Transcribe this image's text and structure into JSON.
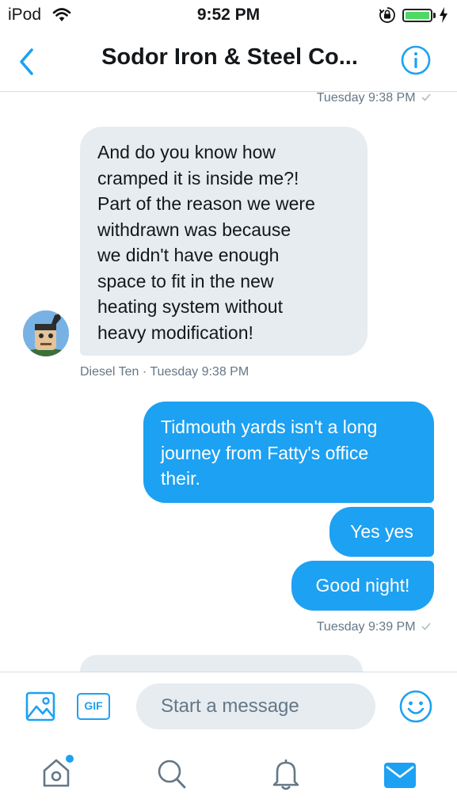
{
  "status_bar": {
    "carrier": "iPod",
    "time": "9:52 PM"
  },
  "header": {
    "title": "Sodor Iron & Steel Co..."
  },
  "messages": [
    {
      "kind": "timestamp",
      "text": "Tuesday 9:38 PM"
    },
    {
      "kind": "received",
      "lines": [
        "And do you know how",
        "cramped it is inside me?!",
        "Part of the reason we were",
        "withdrawn was because",
        "we didn't have enough",
        "space to fit in the new",
        "heating system without",
        "heavy modification!"
      ]
    },
    {
      "kind": "sender",
      "name": "Diesel Ten",
      "time": "Tuesday 9:38 PM"
    },
    {
      "kind": "sent",
      "lines": [
        "Tidmouth yards isn't a long",
        "journey from Fatty's office",
        "their."
      ]
    },
    {
      "kind": "sent",
      "text": "Yes yes"
    },
    {
      "kind": "sent",
      "text": "Good night!"
    },
    {
      "kind": "timestamp",
      "text": "Tuesday 9:39 PM"
    }
  ],
  "composer": {
    "gif_label": "GIF",
    "placeholder": "Start a message"
  },
  "colors": {
    "accent": "#1da1f2",
    "received_bubble": "#e6ecf0",
    "meta_text": "#657786",
    "battery": "#4cd964"
  },
  "icons": {
    "status": [
      "wifi-icon",
      "rotation-lock-icon",
      "battery-icon",
      "charging-icon"
    ],
    "header": [
      "back-chevron-icon",
      "info-icon"
    ],
    "composer": [
      "image-icon",
      "gif-icon",
      "emoji-icon"
    ],
    "tabs": [
      "home-icon",
      "search-icon",
      "notifications-icon",
      "messages-icon"
    ]
  }
}
